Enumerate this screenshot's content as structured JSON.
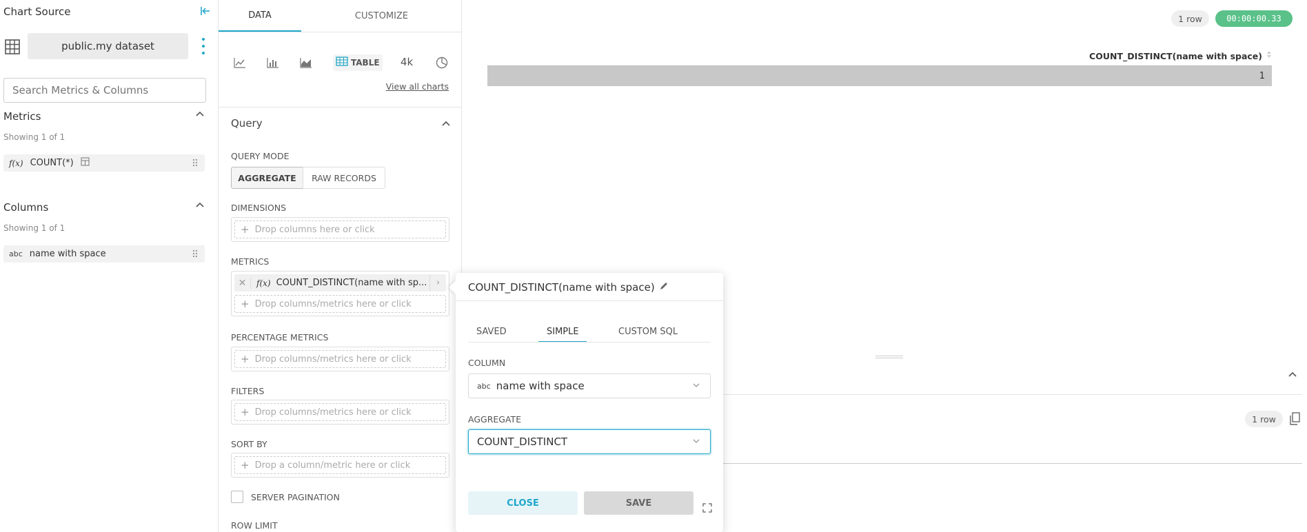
{
  "left": {
    "title": "Chart Source",
    "dataset": "public.my dataset",
    "search_placeholder": "Search Metrics & Columns",
    "metrics": {
      "title": "Metrics",
      "count": "Showing 1 of 1",
      "item": "COUNT(*)",
      "fx": "f(x)"
    },
    "columns": {
      "title": "Columns",
      "count": "Showing 1 of 1",
      "item": "name with space",
      "type": "abc"
    }
  },
  "mid": {
    "tabs": [
      "DATA",
      "CUSTOMIZE"
    ],
    "chart_table_label": "TABLE",
    "chart_4k_label": "4k",
    "view_all": "View all charts",
    "query_title": "Query",
    "query_mode_label": "QUERY MODE",
    "mode_aggregate": "AGGREGATE",
    "mode_raw": "RAW RECORDS",
    "dimensions_label": "DIMENSIONS",
    "drop_columns": "Drop columns here or click",
    "metrics_label": "METRICS",
    "metric_chip": "COUNT_DISTINCT(name with sp...",
    "fx": "f(x)",
    "drop_columns_metrics": "Drop columns/metrics here or click",
    "percentage_label": "PERCENTAGE METRICS",
    "filters_label": "FILTERS",
    "sortby_label": "SORT BY",
    "drop_column_metric": "Drop a column/metric here or click",
    "server_pagination": "SERVER PAGINATION",
    "row_limit": "ROW LIMIT"
  },
  "right": {
    "rows_badge": "1 row",
    "timer": "00:00:00.33",
    "table_header": "COUNT_DISTINCT(name with space)",
    "table_value": "1",
    "rows_badge_2": "1 row",
    "colors": {
      "timer": "#5ac189",
      "row_bg": "#c8c8c8"
    }
  },
  "popover": {
    "title": "COUNT_DISTINCT(name with space)",
    "tabs": [
      "SAVED",
      "SIMPLE",
      "CUSTOM SQL"
    ],
    "column_label": "COLUMN",
    "column_type": "abc",
    "column_value": "name with space",
    "aggregate_label": "AGGREGATE",
    "aggregate_value": "COUNT_DISTINCT",
    "close": "CLOSE",
    "save": "SAVE",
    "colors": {
      "accent": "#20a7c9",
      "close_bg": "#e6f4f8",
      "save_bg": "#d9d9d9"
    }
  }
}
